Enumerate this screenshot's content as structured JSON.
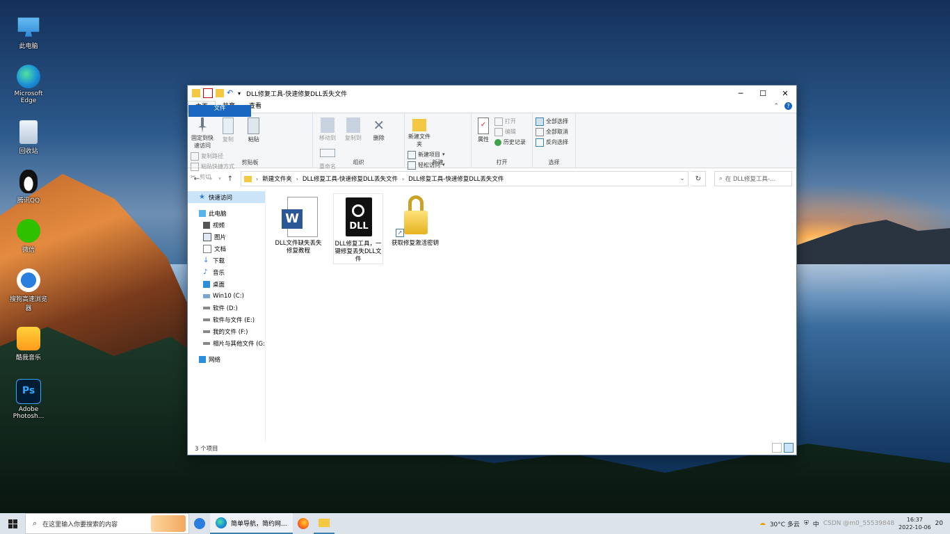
{
  "desktop": {
    "icons": [
      {
        "label": "此电脑"
      },
      {
        "label": "Microsoft Edge"
      },
      {
        "label": "回收站"
      },
      {
        "label": "腾讯QQ"
      },
      {
        "label": "微信"
      },
      {
        "label": "搜狗高速浏览器"
      },
      {
        "label": "酷我音乐"
      },
      {
        "label": "Adobe Photosh..."
      }
    ]
  },
  "window": {
    "title": "DLL修复工具-快速修复DLL丢失文件",
    "controls": {
      "minimize": "─",
      "maximize": "☐",
      "close": "✕"
    },
    "tabs": {
      "file": "文件",
      "home": "主页",
      "share": "共享",
      "view": "查看"
    },
    "ribbon": {
      "clipboard": {
        "label": "剪贴板",
        "pin": "固定到快速访问",
        "copy": "复制",
        "paste": "粘贴",
        "copy_path": "复制路径",
        "paste_shortcut": "粘贴快捷方式",
        "cut": "剪切"
      },
      "organize": {
        "label": "组织",
        "move_to": "移动到",
        "copy_to": "复制到",
        "delete": "删除",
        "rename": "重命名"
      },
      "new": {
        "label": "新建",
        "new_folder": "新建文件夹",
        "new_item": "新建项目",
        "easy_access": "轻松访问"
      },
      "open": {
        "label": "打开",
        "properties": "属性",
        "open": "打开",
        "edit": "编辑",
        "history": "历史记录"
      },
      "select": {
        "label": "选择",
        "select_all": "全部选择",
        "select_none": "全部取消",
        "invert": "反向选择"
      }
    },
    "address": {
      "crumbs": [
        "新建文件夹",
        "DLL修复工具-快速修复DLL丢失文件",
        "DLL修复工具-快速修复DLL丢失文件"
      ],
      "search_placeholder": "在 DLL修复工具-..."
    },
    "nav": {
      "quick_access": "快速访问",
      "this_pc": "此电脑",
      "videos": "视频",
      "pictures": "图片",
      "documents": "文档",
      "downloads": "下载",
      "music": "音乐",
      "desktop": "桌面",
      "drive_c": "Win10 (C:)",
      "drive_d": "软件 (D:)",
      "drive_e": "软件与文件 (E:)",
      "drive_f": "我的文件 (F:)",
      "drive_g": "相片与其他文件 (G:",
      "network": "网络"
    },
    "files": [
      {
        "name": "DLL文件缺失丢失修复教程"
      },
      {
        "name": "DLL修复工具，一键修复丢失DLL文件"
      },
      {
        "name": "获取修复激活密钥"
      }
    ],
    "status": "3 个项目"
  },
  "taskbar": {
    "search_placeholder": "在这里输入你要搜索的内容",
    "browser_app": "简单导航，简约网...",
    "weather": "30°C  多云",
    "ime": "中",
    "time": "16:37",
    "date": "2022-10-06",
    "watermark": "CSDN @m0_55539848",
    "notification_count": "20"
  }
}
